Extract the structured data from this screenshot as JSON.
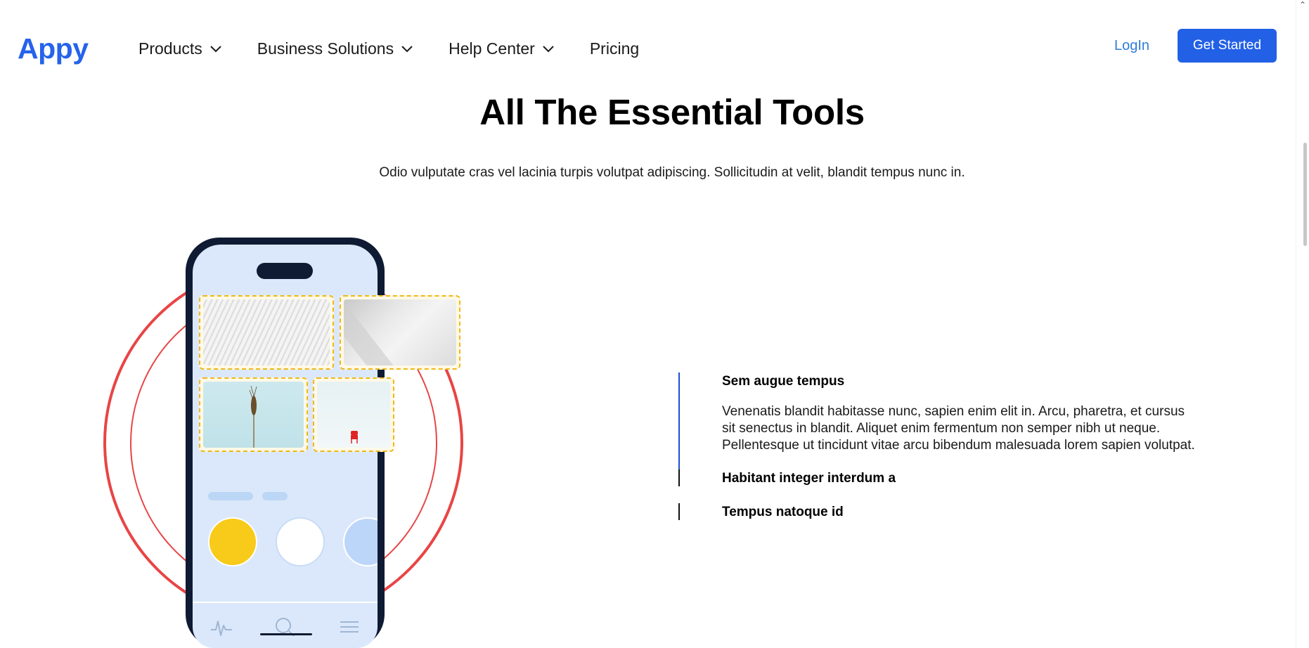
{
  "header": {
    "logo": "Appy",
    "nav": [
      {
        "label": "Products",
        "has_dropdown": true
      },
      {
        "label": "Business Solutions",
        "has_dropdown": true
      },
      {
        "label": "Help Center",
        "has_dropdown": true
      },
      {
        "label": "Pricing",
        "has_dropdown": false
      }
    ],
    "login_label": "LogIn",
    "cta_label": "Get Started"
  },
  "hero": {
    "title": "All The Essential Tools",
    "subtitle": "Odio vulputate cras vel lacinia turpis volutpat adipiscing. Sollicitudin at velit, blandit tempus nunc in."
  },
  "features": [
    {
      "title": "Sem augue tempus",
      "body": "Venenatis blandit habitasse nunc, sapien enim elit in. Arcu, pharetra, et cursus sit senectus in blandit. Aliquet enim fermentum non semper nibh ut neque. Pellentesque ut tincidunt vitae arcu bibendum malesuada lorem sapien volutpat.",
      "active": true
    },
    {
      "title": "Habitant integer interdum a",
      "active": false
    },
    {
      "title": "Tempus natoque id",
      "active": false
    }
  ],
  "illustration": {
    "phone_tab_icons": [
      "activity-icon",
      "search-icon",
      "menu-icon"
    ],
    "gallery_images": [
      "architecture-image",
      "beam-image",
      "wheat-image",
      "snow-chair-image"
    ]
  },
  "colors": {
    "brand_blue": "#2563eb",
    "button_blue": "#2260e6",
    "link_blue": "#2f7dd8",
    "ring_red": "#e84545",
    "card_dash": "#f0b818",
    "active_bar": "#1f4fd0"
  }
}
